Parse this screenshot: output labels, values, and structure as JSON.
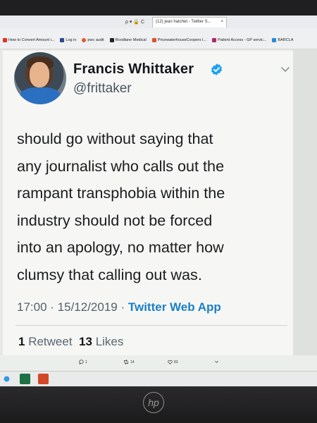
{
  "browser": {
    "tab_title": "(12) jean hatchet - Twitter S...",
    "tab_close": "×",
    "nav_icons": "ρ ▾ 🔒 C",
    "bookmarks": [
      {
        "label": "How to Convert Amount i...",
        "color": "#e0342b"
      },
      {
        "label": "Log in",
        "color": "#2e4a8a"
      },
      {
        "label": "pwc audit",
        "color": "#e05a2b"
      },
      {
        "label": "Roodlane Medical",
        "color": "#222222"
      },
      {
        "label": "PricewaterhouseCoopers I...",
        "color": "#d8572a"
      },
      {
        "label": "Patient Access - GP servic...",
        "color": "#b02a6a"
      },
      {
        "label": "BARCLA",
        "color": "#2a8ad8"
      }
    ]
  },
  "tweet": {
    "display_name": "Francis Whittaker",
    "handle": "@frittaker",
    "text_lines": [
      "should go without saying that",
      "any journalist who calls out the",
      "rampant transphobia within the",
      "industry should not be forced",
      "into an apology, no matter how",
      "clumsy that calling out was."
    ],
    "time": "17:00",
    "date": "15/12/2019",
    "source": "Twitter Web App",
    "retweet_count": "1",
    "retweet_label": "Retweet",
    "like_count": "13",
    "like_label": "Likes",
    "actions": {
      "reply": "1",
      "retweet": "14",
      "like": "83"
    }
  },
  "icons": {
    "verified": "verified-badge-icon",
    "chevron": "chevron-down-icon"
  },
  "colors": {
    "link_blue": "#1b7fc9",
    "verified_blue": "#1da1f2",
    "name_text": "#14171a"
  },
  "monitor": {
    "logo_text": "hp"
  }
}
